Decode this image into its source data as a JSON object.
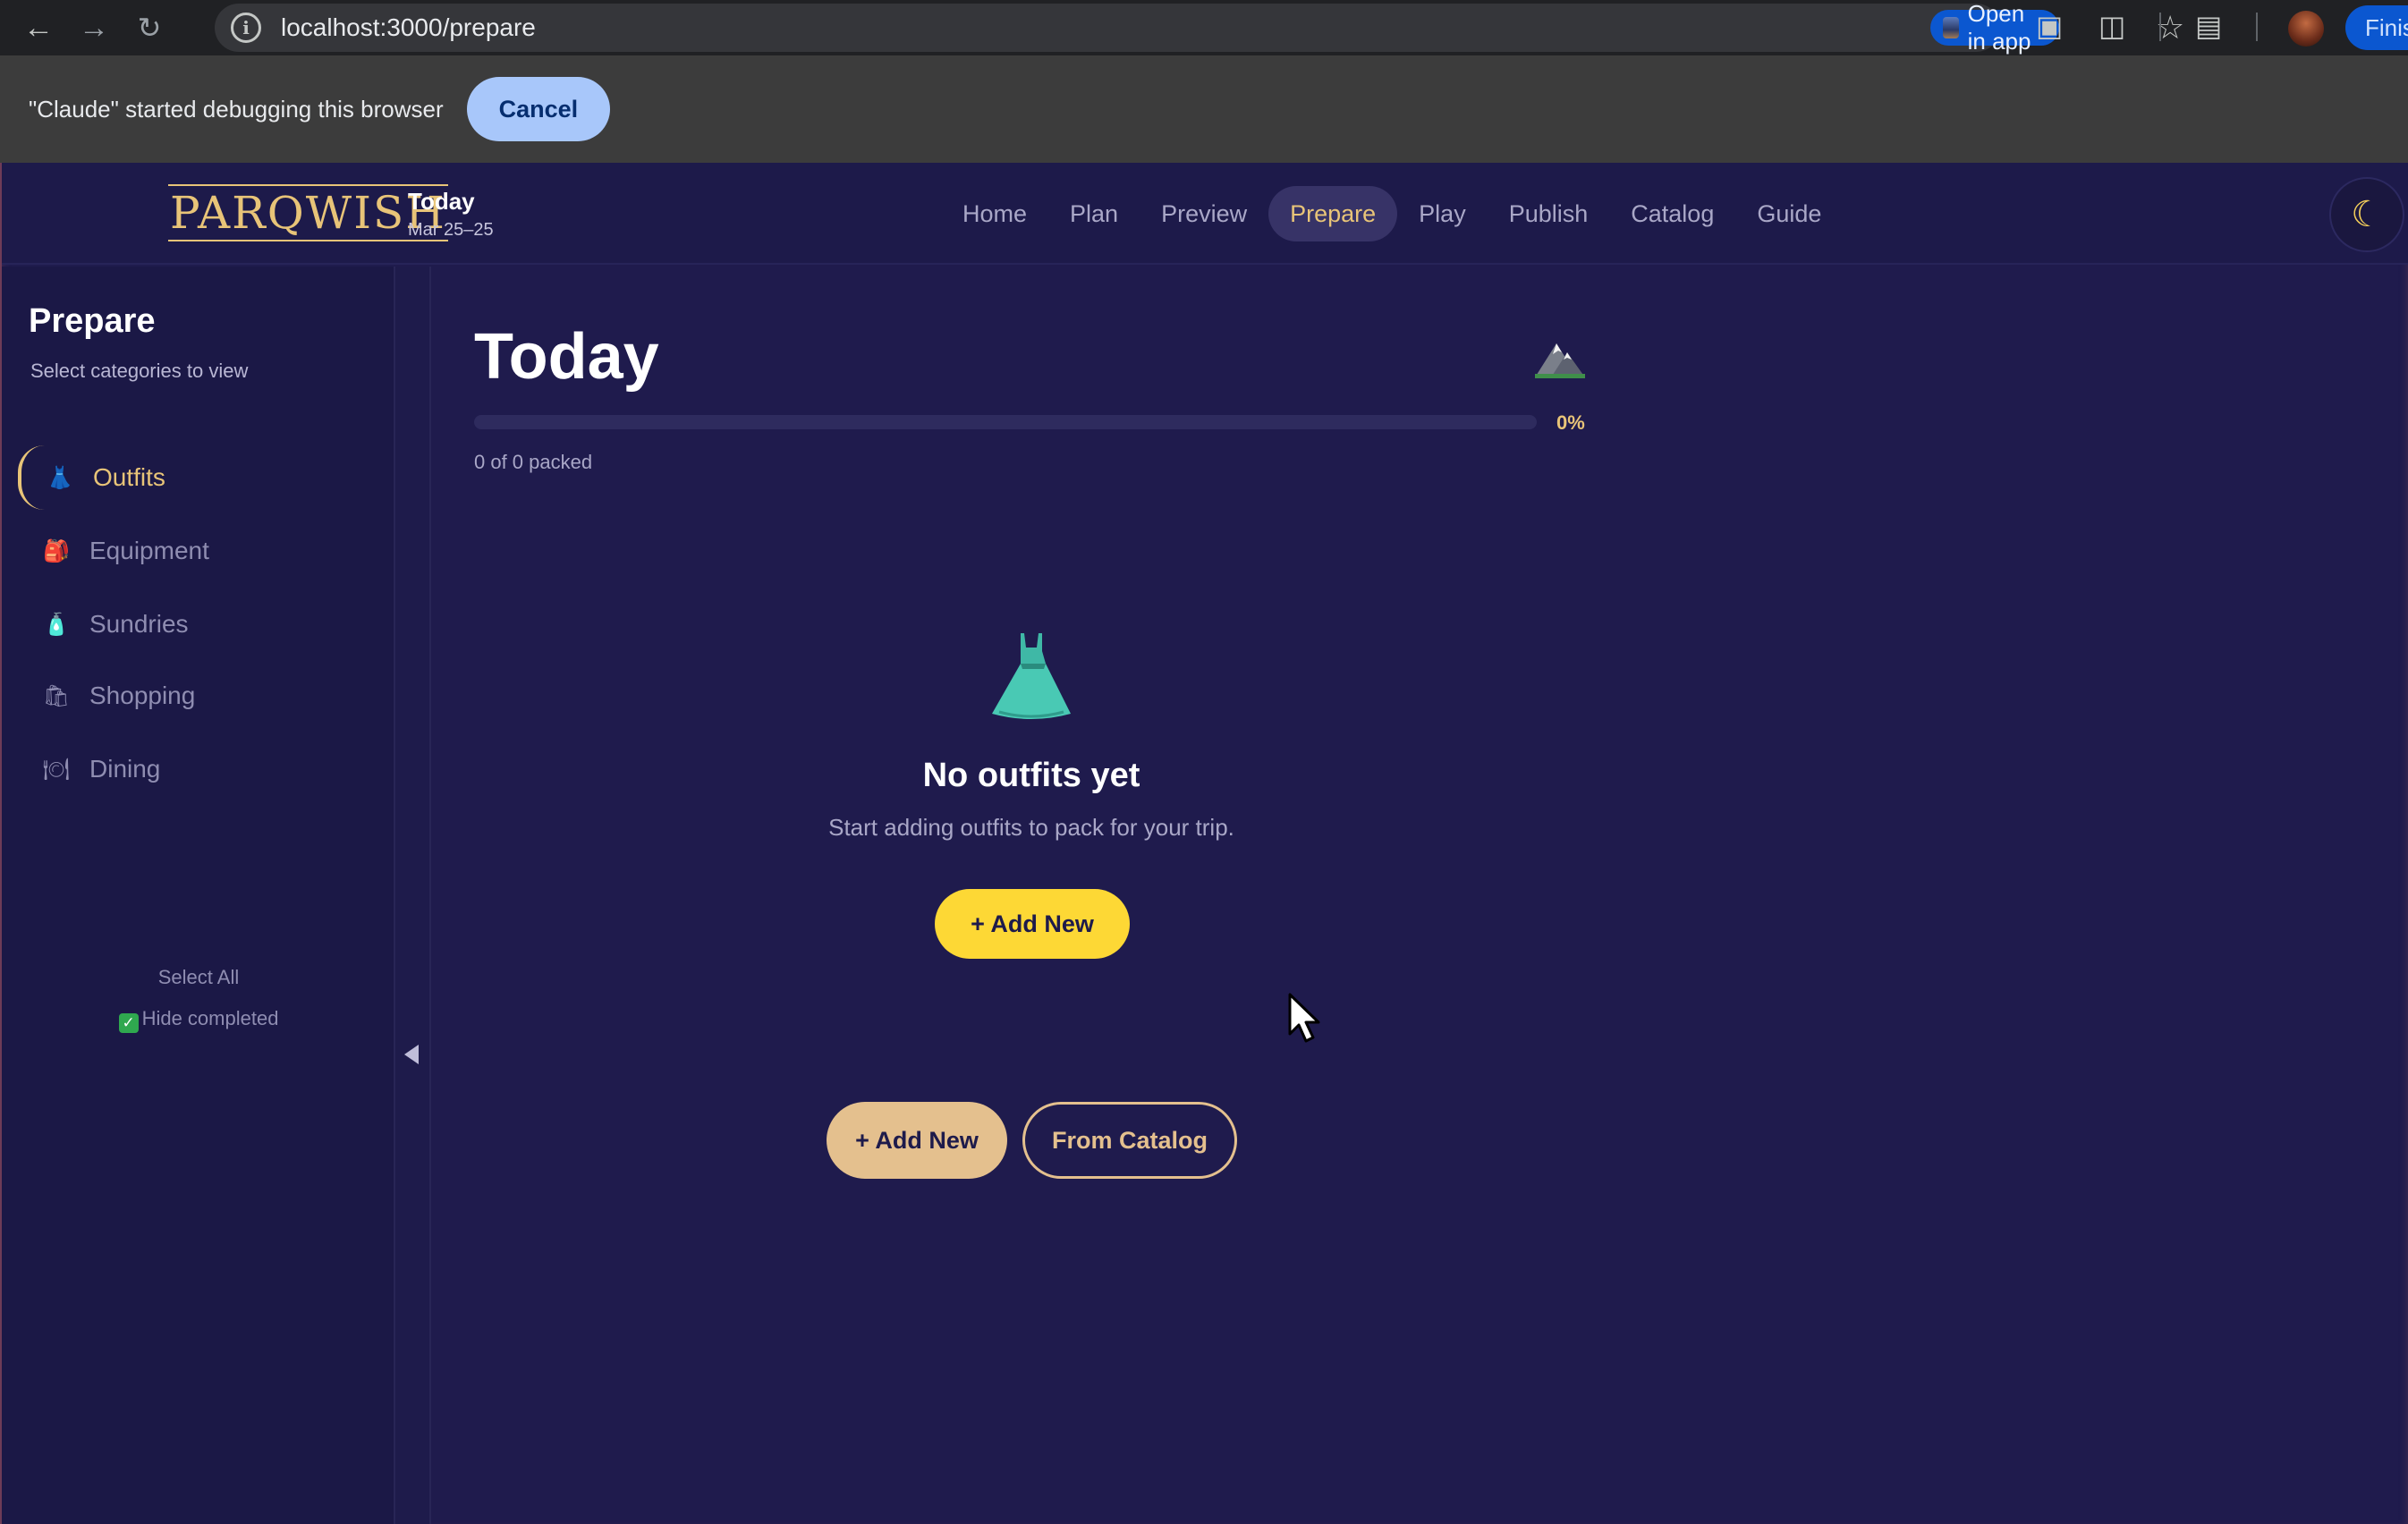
{
  "browser": {
    "url": "localhost:3000/prepare",
    "open_in_app_label": "Open in app",
    "finish_label": "Finis",
    "debug_message": "\"Claude\" started debugging this browser",
    "cancel_label": "Cancel"
  },
  "header": {
    "logo_text": "PARQWISH",
    "trip_title": "Today",
    "trip_dates": "Mar 25–25",
    "tabs": [
      {
        "label": "Home",
        "active": false
      },
      {
        "label": "Plan",
        "active": false
      },
      {
        "label": "Preview",
        "active": false
      },
      {
        "label": "Prepare",
        "active": true
      },
      {
        "label": "Play",
        "active": false
      },
      {
        "label": "Publish",
        "active": false
      },
      {
        "label": "Catalog",
        "active": false
      },
      {
        "label": "Guide",
        "active": false
      }
    ],
    "theme_toggle_icon": "☾"
  },
  "sidebar": {
    "title": "Prepare",
    "subtitle": "Select categories to view",
    "categories": [
      {
        "label": "Outfits",
        "icon": "👗",
        "active": true
      },
      {
        "label": "Equipment",
        "icon": "🎒",
        "active": false
      },
      {
        "label": "Sundries",
        "icon": "🧴",
        "active": false
      },
      {
        "label": "Shopping",
        "icon": "🛍",
        "active": false
      },
      {
        "label": "Dining",
        "icon": "🍽",
        "active": false
      }
    ],
    "select_all_label": "Select All",
    "hide_completed_label": "Hide completed",
    "hide_completed_checked": true
  },
  "main": {
    "title": "Today",
    "progress_percent": 0,
    "progress_label": "0%",
    "packed_count": "0 of 0 packed",
    "empty_title": "No outfits yet",
    "empty_subtitle": "Start adding outfits to pack for your trip.",
    "add_new_label": "+ Add New",
    "footer_add_new_label": "+ Add New",
    "from_catalog_label": "From Catalog"
  },
  "colors": {
    "accent_gold": "#e8c478",
    "add_button_yellow": "#fdd835",
    "app_background": "#1f1b4d"
  }
}
